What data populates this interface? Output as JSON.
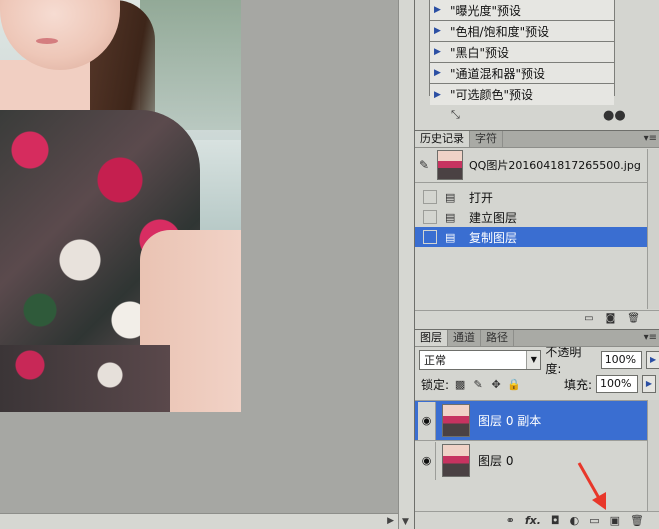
{
  "actions": {
    "items": [
      "\"曝光度\"预设",
      "\"色相/饱和度\"预设",
      "\"黑白\"预设",
      "\"通道混和器\"预设",
      "\"可选颜色\"预设"
    ]
  },
  "history": {
    "tabs": [
      "历史记录",
      "字符"
    ],
    "snapshot_name": "QQ图片20160418172655​00.jpg",
    "states": [
      "打开",
      "建立图层",
      "复制图层"
    ],
    "selected_index": 2
  },
  "layers": {
    "tabs": [
      "图层",
      "通道",
      "路径"
    ],
    "blend_mode": "正常",
    "opacity_label": "不透明度:",
    "opacity_value": "100%",
    "lock_label": "锁定:",
    "fill_label": "填充:",
    "fill_value": "100%",
    "items": [
      "图层 0 副本",
      "图层 0"
    ],
    "selected_index": 0,
    "footer_fx": "fx."
  },
  "colors": {
    "selection": "#3a6ed1",
    "panel_bg": "#d4d5d0",
    "canvas_bg": "#a6a7a3",
    "arrow": "#e8372a"
  }
}
